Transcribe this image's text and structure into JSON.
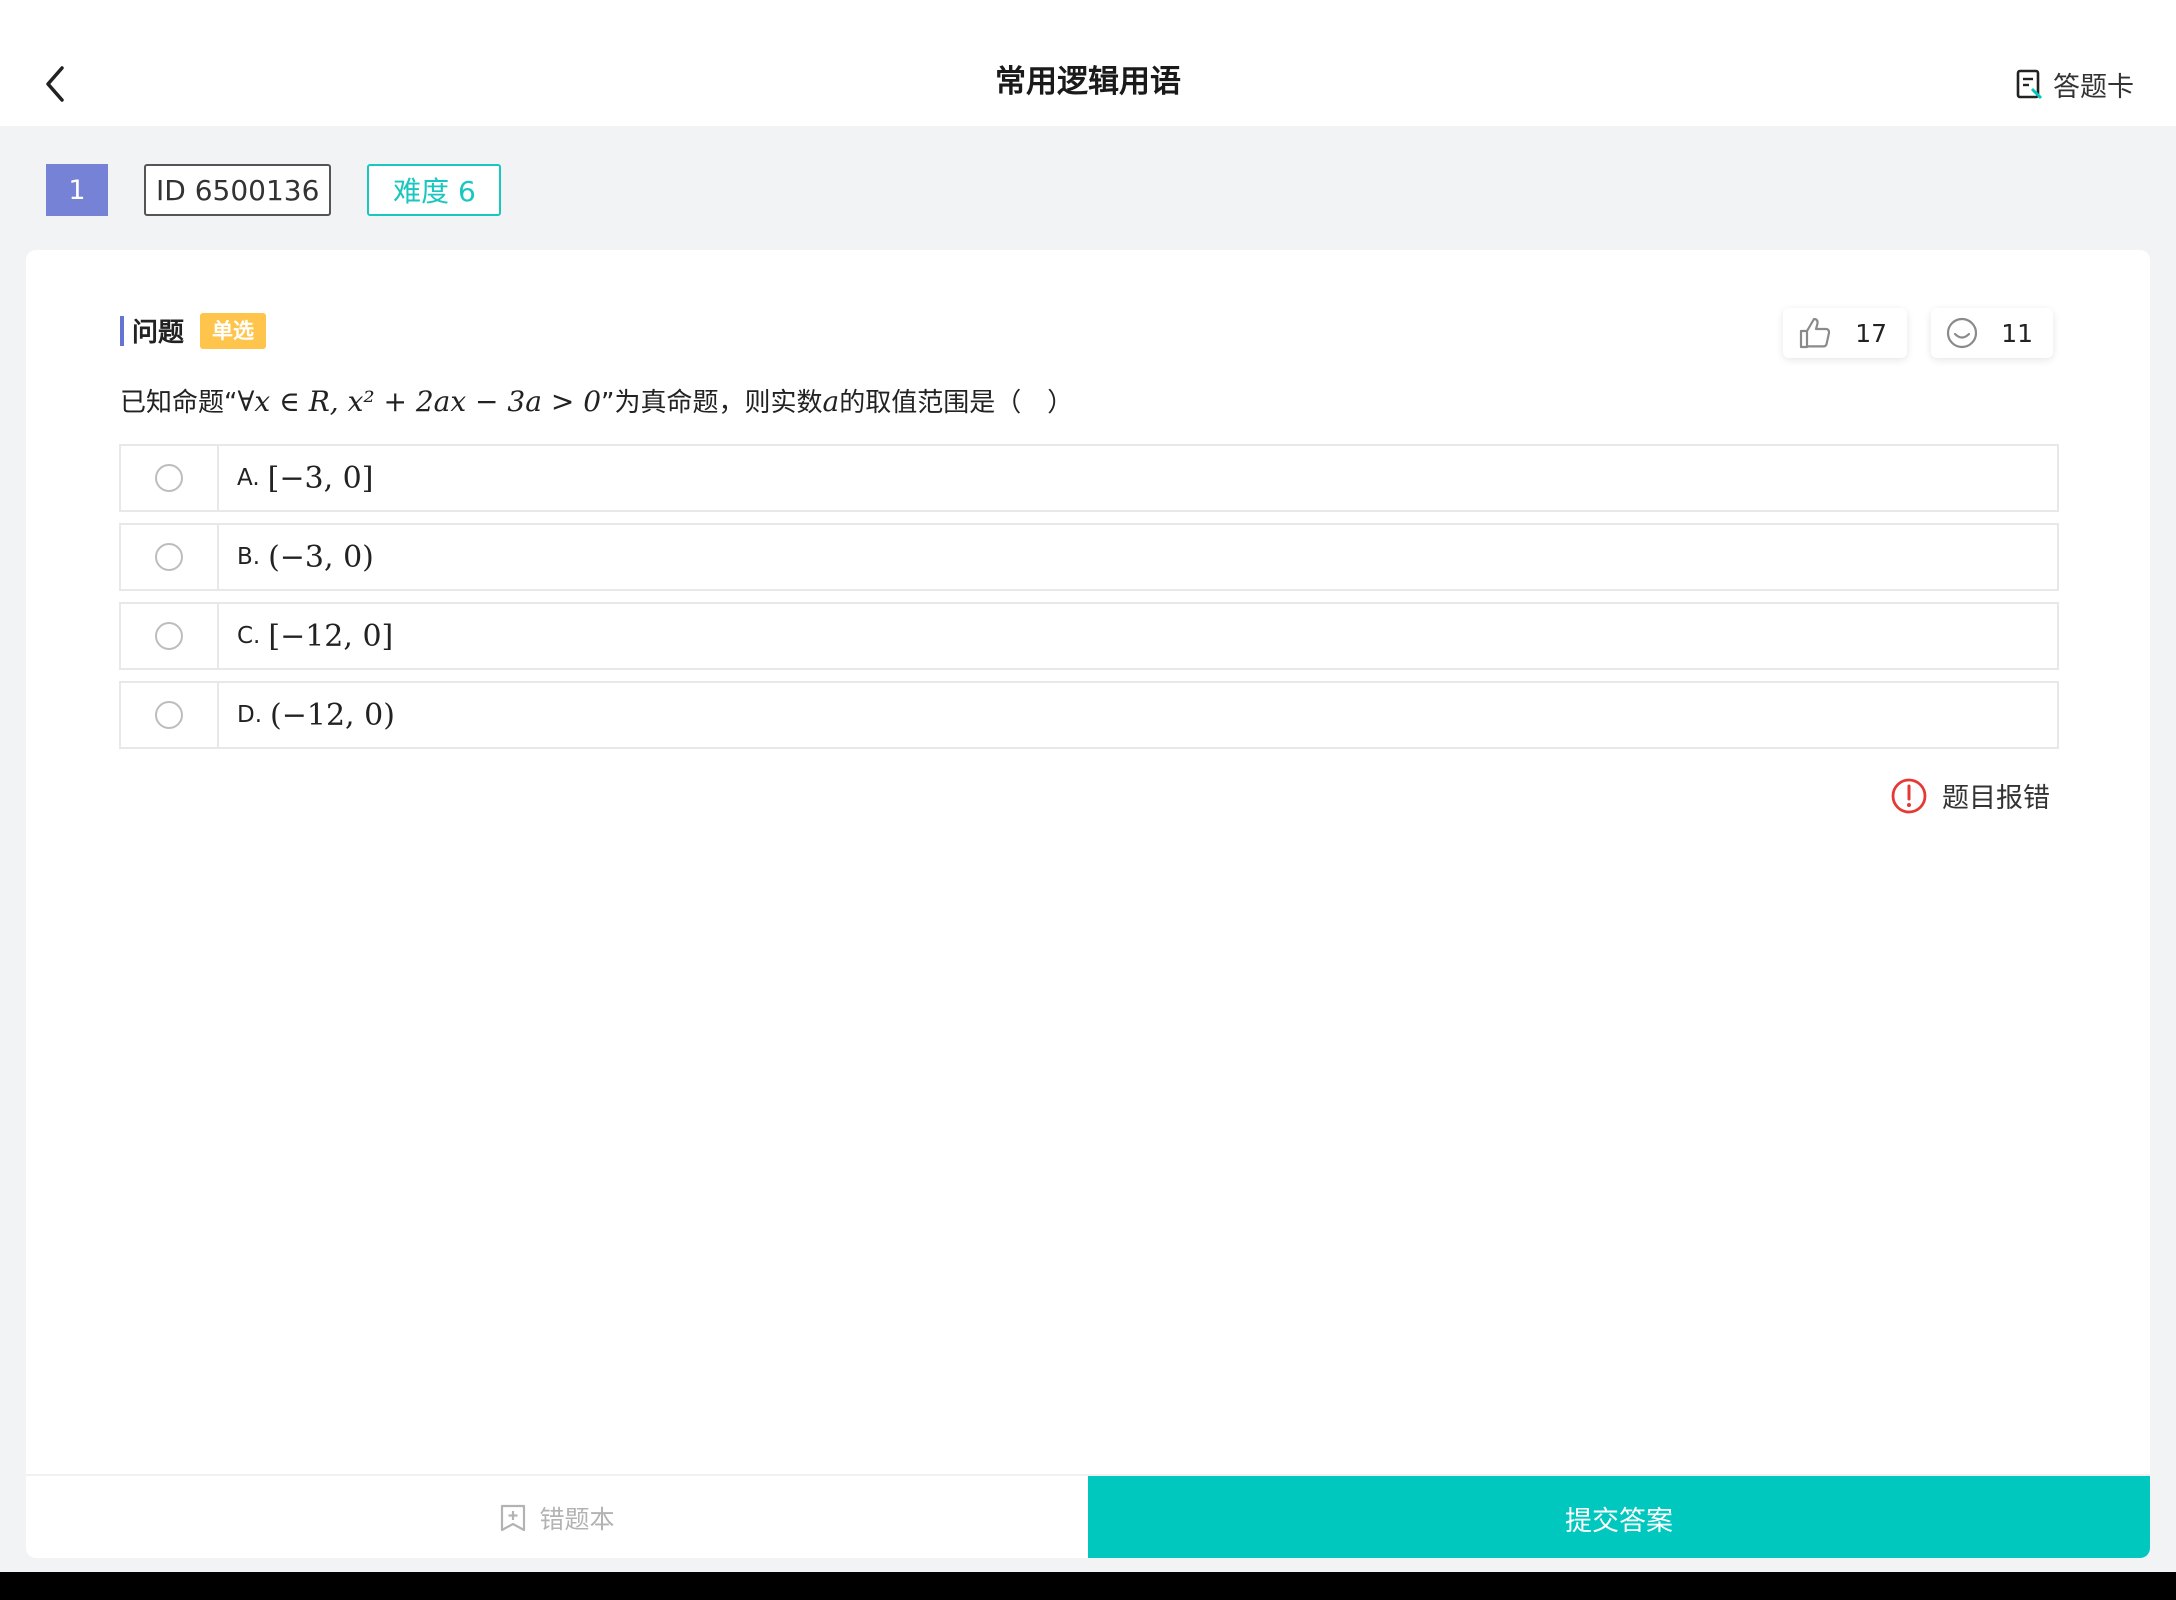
{
  "header": {
    "title": "常用逻辑用语",
    "answer_card_label": "答题卡"
  },
  "meta": {
    "number": "1",
    "id_label": "ID 6500136",
    "difficulty_label": "难度 6"
  },
  "question": {
    "section_label": "问题",
    "type_label": "单选",
    "likes": "17",
    "reactions": "11",
    "text_prefix": "已知命题“",
    "text_math": "∀x ∈ R, x² + 2ax − 3a > 0",
    "text_mid": "”为真命题，则实数",
    "text_var": "a",
    "text_suffix": "的取值范围是（　）"
  },
  "options": [
    {
      "letter": "A.",
      "value": "[−3, 0]"
    },
    {
      "letter": "B.",
      "value": "(−3, 0)"
    },
    {
      "letter": "C.",
      "value": "[−12, 0]"
    },
    {
      "letter": "D.",
      "value": "(−12, 0)"
    }
  ],
  "report_label": "题目报错",
  "footer": {
    "wrongbook_label": "错题本",
    "submit_label": "提交答案"
  },
  "colors": {
    "accent_teal": "#00c8bf",
    "badge_purple": "#7682d6",
    "type_orange": "#ffc44c",
    "report_red": "#e53935"
  }
}
